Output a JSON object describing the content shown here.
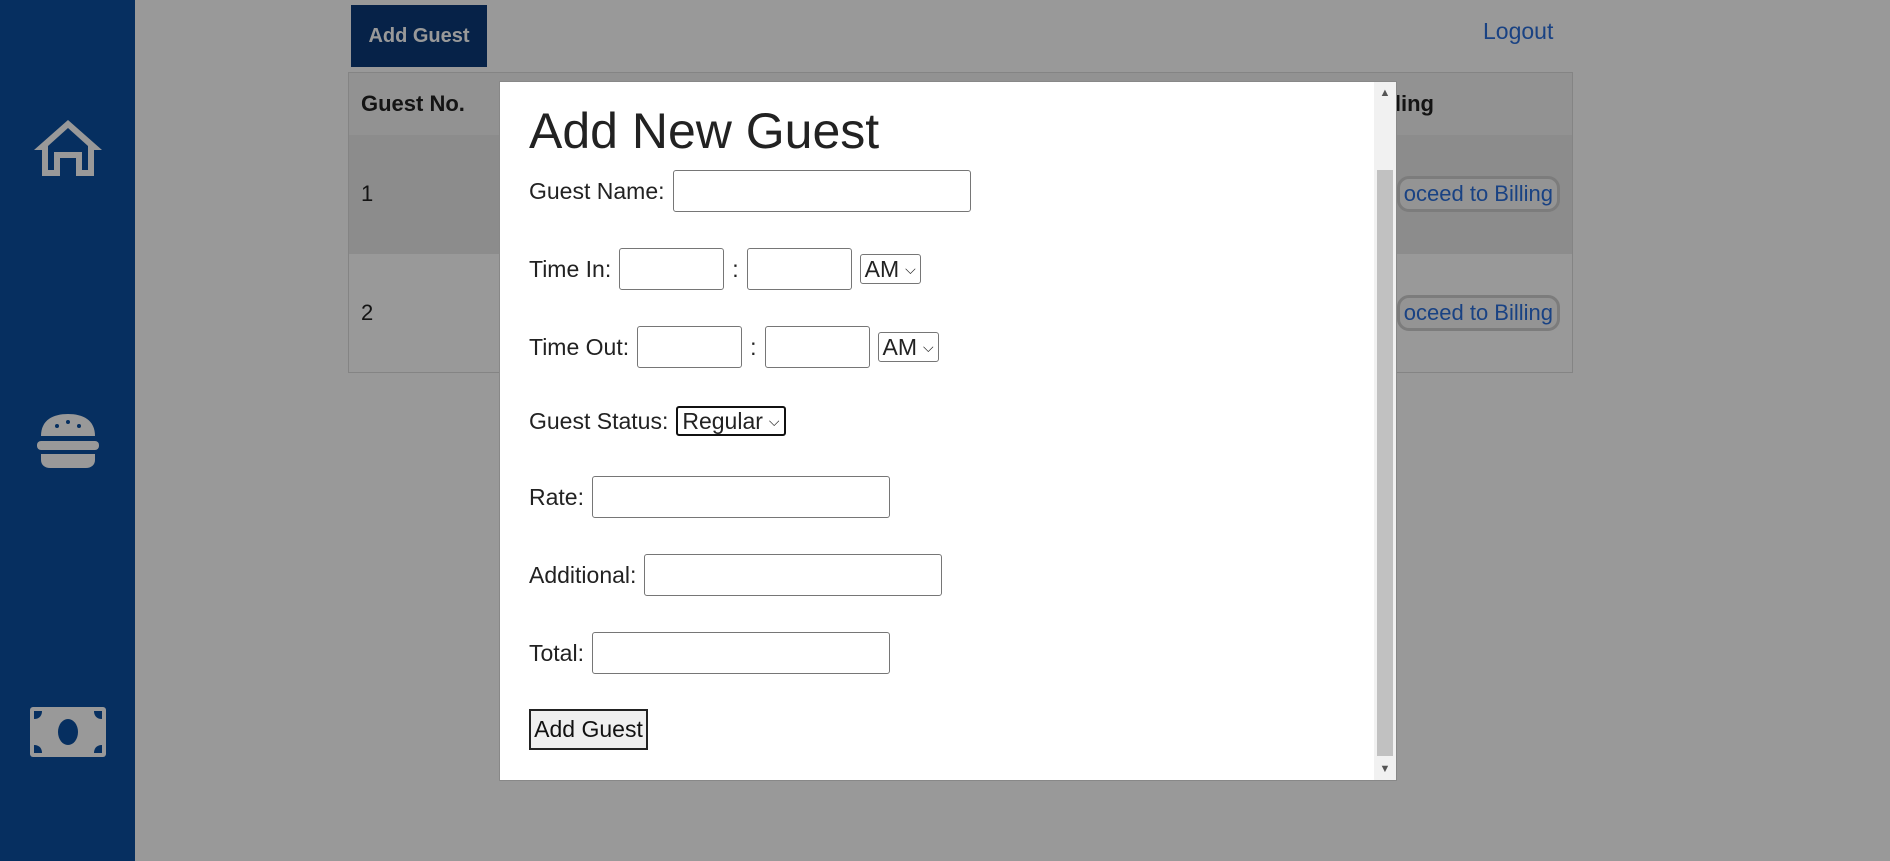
{
  "sidebar": {
    "items": [
      {
        "icon": "home-icon"
      },
      {
        "icon": "burger-icon"
      },
      {
        "icon": "money-icon"
      }
    ],
    "color": "#0a4fa0"
  },
  "toolbar": {
    "add_guest_label": "Add Guest",
    "logout_label": "Logout"
  },
  "table": {
    "headers": [
      "Guest No.",
      "",
      "",
      "",
      "",
      "",
      "lling"
    ],
    "rows": [
      {
        "no": "1",
        "billing": "oceed to Billing"
      },
      {
        "no": "2",
        "billing": "oceed to Billing"
      }
    ]
  },
  "modal": {
    "title": "Add New Guest",
    "guest_name_label": "Guest Name:",
    "guest_name_value": "",
    "time_in_label": "Time In:",
    "time_in_hour": "",
    "time_in_minute": "",
    "time_in_colon": ":",
    "time_in_period": "AM",
    "time_out_label": "Time Out:",
    "time_out_hour": "",
    "time_out_minute": "",
    "time_out_colon": ":",
    "time_out_period": "AM",
    "guest_status_label": "Guest Status:",
    "guest_status_value": "Regular",
    "rate_label": "Rate:",
    "rate_value": "",
    "additional_label": "Additional:",
    "additional_value": "",
    "total_label": "Total:",
    "total_value": "",
    "submit_label": "Add Guest"
  }
}
